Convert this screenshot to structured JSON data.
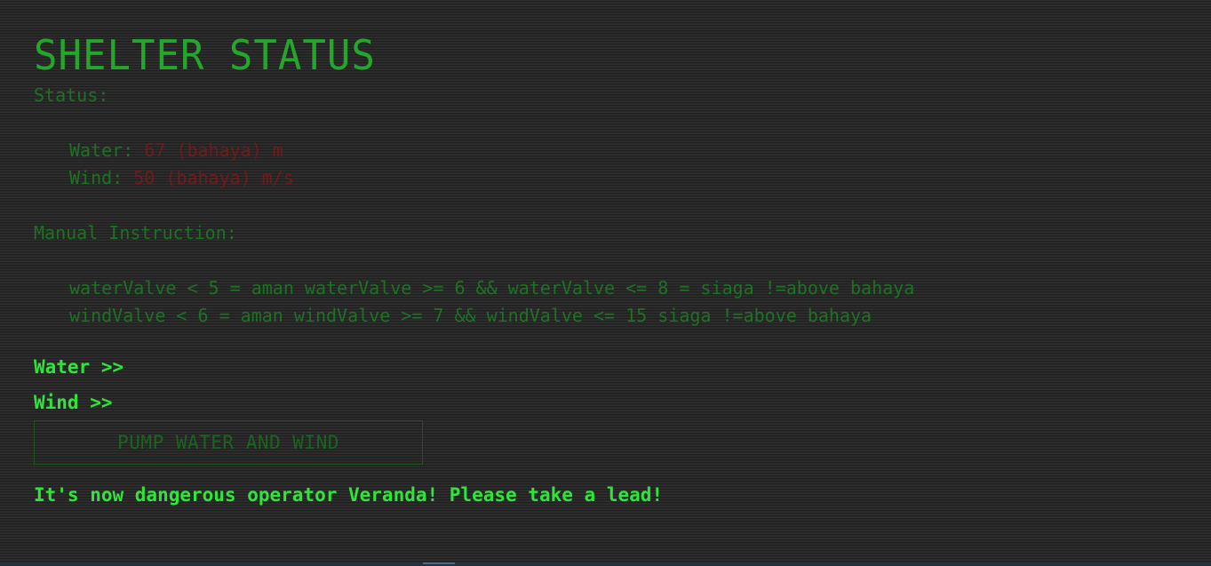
{
  "title": "SHELTER STATUS",
  "status": {
    "label": "Status:",
    "water": {
      "label": "Water:",
      "value": "67 (bahaya) m"
    },
    "wind": {
      "label": "Wind:",
      "value": "50 (bahaya) m/s"
    }
  },
  "manual": {
    "label": "Manual Instruction:",
    "lines": [
      "waterValve < 5 = aman waterValve >= 6 && waterValve <= 8 = siaga !=above bahaya",
      "windValve < 6 = aman windValve >= 7 && windValve <= 15 siaga !=above bahaya"
    ]
  },
  "nav": {
    "water": "Water >>",
    "wind": "Wind >>"
  },
  "pump_button": "PUMP WATER AND WIND",
  "message": "It's now dangerous operator Veranda! Please take a lead!",
  "colors": {
    "background": "#262626",
    "text_green": "#2ee63a",
    "dim_green": "#1a8a22",
    "danger_red": "#8a1616"
  }
}
